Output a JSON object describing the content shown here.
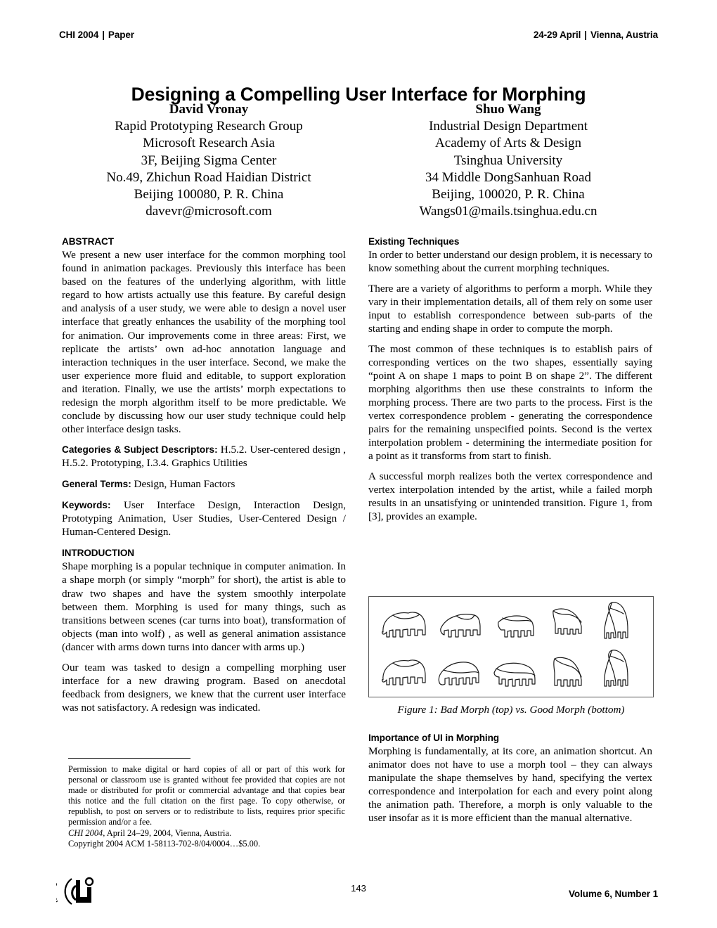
{
  "header": {
    "left_conference": "CHI 2004",
    "separator": "|",
    "left_type": "Paper",
    "right_dates": "24-29 April",
    "right_location": "Vienna, Austria"
  },
  "title": "Designing a Compelling User Interface for Morphing",
  "authors": [
    {
      "name": "David Vronay",
      "lines": [
        "Rapid Prototyping Research Group",
        "Microsoft Research Asia",
        "3F, Beijing Sigma Center",
        "No.49, Zhichun Road Haidian District",
        "Beijing 100080, P. R. China",
        "davevr@microsoft.com"
      ]
    },
    {
      "name": "Shuo Wang",
      "lines": [
        "Industrial Design Department",
        "Academy of Arts & Design",
        "Tsinghua University",
        "34 Middle DongSanhuan Road",
        "Beijing, 100020, P. R. China",
        "Wangs01@mails.tsinghua.edu.cn"
      ]
    }
  ],
  "left_column": {
    "abstract_heading": "ABSTRACT",
    "abstract_text": "We present a new user interface for the common morphing tool found in animation packages. Previously this interface has been based on the features of the underlying algorithm, with little regard to how artists actually use this feature. By careful design and analysis of a user study, we were able to design a novel user interface that greatly enhances the usability of the morphing tool for animation. Our improvements come in three areas:  First, we replicate the artists’ own ad-hoc annotation language and interaction techniques in the user interface. Second, we make the user experience more fluid and editable, to support exploration and iteration. Finally, we use the artists’ morph expectations to redesign the morph algorithm itself to be more predictable. We conclude by discussing how our user study technique could help other interface design tasks.",
    "categories_label": "Categories & Subject Descriptors:",
    "categories_text": "H.5.2. User-centered design , H.5.2. Prototyping, I.3.4. Graphics Utilities",
    "general_terms_label": "General Terms:",
    "general_terms_text": "Design, Human Factors",
    "keywords_label": "Keywords:",
    "keywords_text": "User Interface Design, Interaction Design, Prototyping Animation, User Studies, User-Centered Design / Human-Centered Design.",
    "introduction_heading": "INTRODUCTION",
    "intro_para_1": "Shape morphing is a popular technique in computer animation. In a shape morph (or simply “morph” for short), the artist is able to draw two shapes and have the system smoothly interpolate between them. Morphing is used for many things, such as transitions between scenes (car turns into boat), transformation of objects (man into wolf) , as well as general animation assistance (dancer with arms down turns into dancer with arms up.)",
    "intro_para_2": "Our team was tasked to design a compelling morphing user interface for a new drawing program. Based on anecdotal feedback from designers, we knew that the current user interface was not satisfactory. A redesign was indicated."
  },
  "copyright": {
    "permission": "Permission to make digital or hard copies of all or part of this work for personal or classroom use is granted without fee provided that copies are not made or distributed for profit or commercial advantage and that copies bear this notice and the full citation on the first page. To copy otherwise, or republish, to post on servers or to redistribute to lists, requires prior specific permission and/or a fee.",
    "conference_italic": "CHI 2004,",
    "conference_rest": " April 24–29, 2004, Vienna, Austria.",
    "copyright_line": "Copyright 2004 ACM 1-58113-702-8/04/0004…$5.00."
  },
  "right_column": {
    "existing_heading": "Existing Techniques",
    "existing_para_1": "In order to better understand our design problem, it is necessary to know something about the current morphing techniques.",
    "existing_para_2": "There are a variety of algorithms to perform a morph. While they vary in their implementation details, all of them rely on some user input to establish correspondence between sub-parts of the starting and ending shape in order to compute the morph.",
    "existing_para_3": "The most common of these techniques is to establish pairs of corresponding vertices on the two shapes, essentially saying “point A on shape 1 maps to point B on shape 2”. The different morphing algorithms then use these constraints to inform the morphing process. There are two parts to the process. First is the vertex correspondence problem - generating the correspondence pairs for the remaining unspecified points. Second is the vertex interpolation problem - determining the intermediate position for a point as it transforms from start to finish.",
    "existing_para_4": "A successful morph realizes both the vertex correspondence and vertex interpolation intended by the artist, while a failed morph results in an unsatisfying or unintended transition. Figure 1, from [3], provides an example.",
    "figure_caption": "Figure 1:  Bad Morph (top) vs. Good Morph (bottom)",
    "importance_heading": "Importance of UI in Morphing",
    "importance_para_1": "Morphing is fundamentally, at its core, an animation shortcut. An animator does not have to use a morph tool – they can always manipulate the shape themselves by hand, specifying the vertex correspondence and interpolation for each and every point along the animation path. Therefore, a morph is only valuable to the user insofar as it is more efficient than the manual alternative."
  },
  "figure": {
    "name": "morph-sequence-figure",
    "rows": [
      {
        "label": "bad-morph-row",
        "frames": [
          "elephant",
          "elephant-trunk-lifting",
          "mid-morph",
          "near-giraffe",
          "giraffe"
        ]
      },
      {
        "label": "good-morph-row",
        "frames": [
          "elephant",
          "elephant-trunk-extending",
          "mid-morph",
          "near-giraffe",
          "giraffe"
        ]
      }
    ]
  },
  "footer": {
    "logo_text_arc": "letters",
    "logo_text_main": "chi",
    "page_number": "143",
    "volume": "Volume 6, Number 1"
  }
}
